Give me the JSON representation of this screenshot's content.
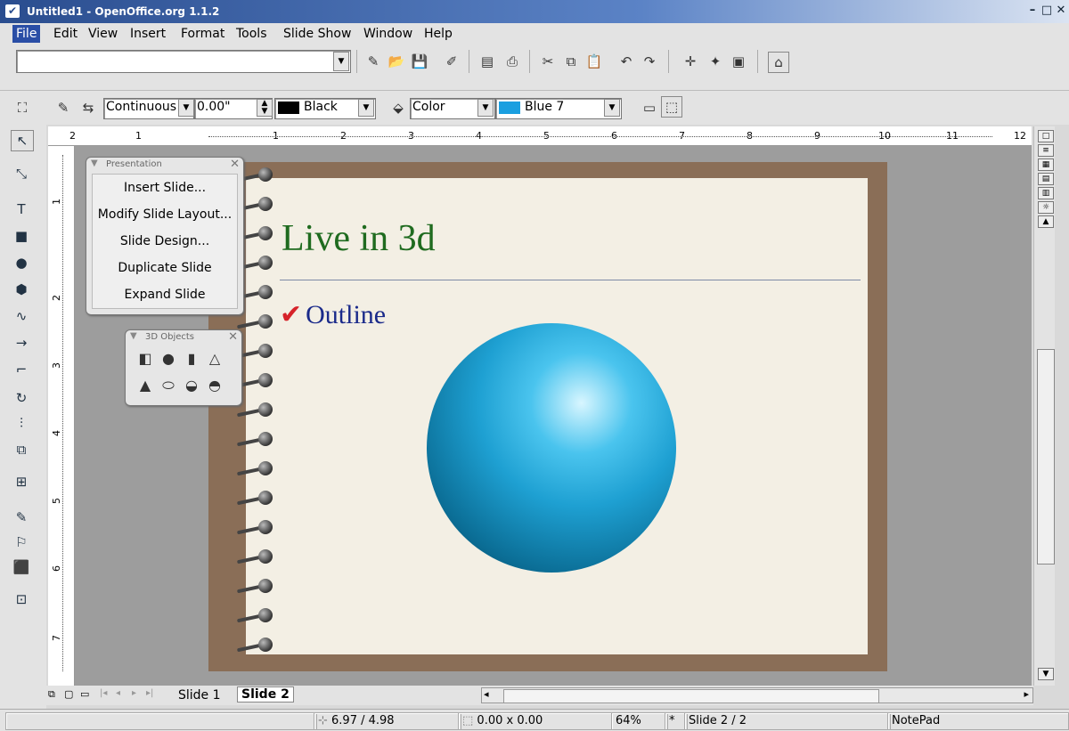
{
  "window": {
    "title": "Untitled1 - OpenOffice.org 1.1.2"
  },
  "menu": [
    "File",
    "Edit",
    "View",
    "Insert",
    "Format",
    "Tools",
    "Slide Show",
    "Window",
    "Help"
  ],
  "line_toolbar": {
    "line_style": "Continuous",
    "line_width": "0.00\"",
    "line_color": "Black",
    "line_color_hex": "#000000",
    "area_style": "Color",
    "area_color": "Blue 7",
    "area_color_hex": "#1a9fe0"
  },
  "ruler": {
    "h_labels": [
      "2",
      "1",
      "1",
      "2",
      "3",
      "4",
      "5",
      "6",
      "7",
      "8",
      "9",
      "10",
      "11",
      "12"
    ],
    "v_labels": [
      "1",
      "2",
      "3",
      "4",
      "5",
      "6",
      "7"
    ]
  },
  "slide": {
    "title": "Live in 3d",
    "bullet": "Outline"
  },
  "presentation_palette": {
    "title": "Presentation",
    "items": [
      "Insert Slide...",
      "Modify Slide Layout...",
      "Slide Design...",
      "Duplicate Slide",
      "Expand Slide"
    ]
  },
  "objects_palette": {
    "title": "3D Objects"
  },
  "tabs": [
    "Slide 1",
    "Slide 2"
  ],
  "status": {
    "position": "6.97 / 4.98",
    "size": "0.00 x 0.00",
    "zoom": "64%",
    "modified": "*",
    "slide": "Slide 2 / 2",
    "layout": "NotePad"
  }
}
